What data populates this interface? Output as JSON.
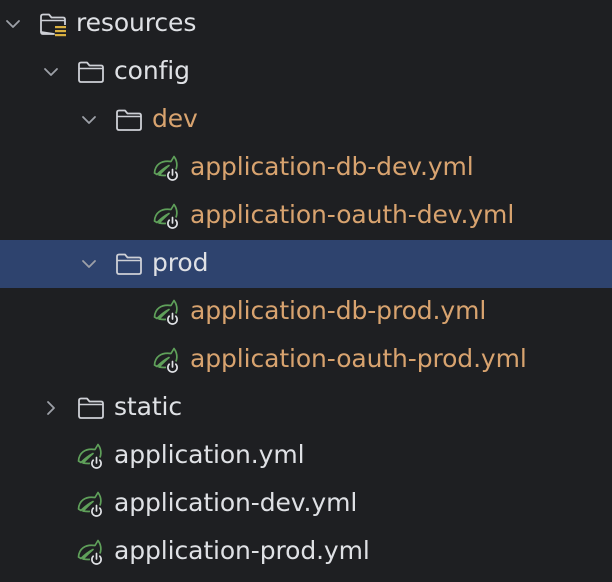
{
  "colors": {
    "background": "#1e1f22",
    "selection": "#2e436e",
    "text": "#dfe1e5",
    "excluded_text": "#d8a36f",
    "spring_green": "#5fa05a",
    "folder_stroke": "#ced0d6",
    "resources_badge": "#d9b040"
  },
  "tree": {
    "selected_item": "prod",
    "items": [
      {
        "label": "resources",
        "type": "resources-folder",
        "expanded": true,
        "icon": "resources-folder-icon"
      },
      {
        "label": "config",
        "type": "folder",
        "expanded": true,
        "icon": "folder-icon"
      },
      {
        "label": "dev",
        "type": "folder",
        "expanded": true,
        "icon": "folder-icon"
      },
      {
        "label": "application-db-dev.yml",
        "type": "spring-yaml-file",
        "icon": "spring-config-icon"
      },
      {
        "label": "application-oauth-dev.yml",
        "type": "spring-yaml-file",
        "icon": "spring-config-icon"
      },
      {
        "label": "prod",
        "type": "folder",
        "expanded": true,
        "icon": "folder-icon"
      },
      {
        "label": "application-db-prod.yml",
        "type": "spring-yaml-file",
        "icon": "spring-config-icon"
      },
      {
        "label": "application-oauth-prod.yml",
        "type": "spring-yaml-file",
        "icon": "spring-config-icon"
      },
      {
        "label": "static",
        "type": "folder",
        "expanded": false,
        "icon": "folder-icon"
      },
      {
        "label": "application.yml",
        "type": "spring-yaml-file",
        "icon": "spring-config-icon"
      },
      {
        "label": "application-dev.yml",
        "type": "spring-yaml-file",
        "icon": "spring-config-icon"
      },
      {
        "label": "application-prod.yml",
        "type": "spring-yaml-file",
        "icon": "spring-config-icon"
      }
    ]
  }
}
